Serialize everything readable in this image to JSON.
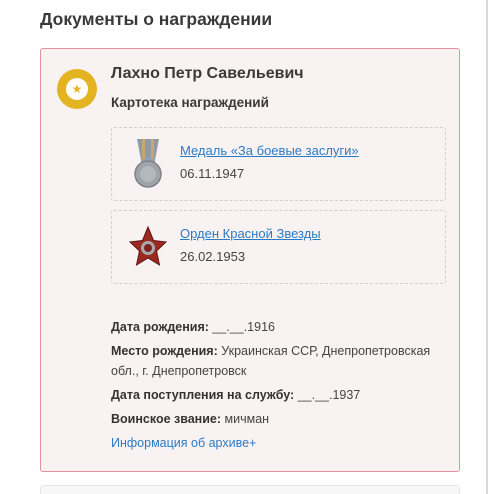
{
  "section": {
    "title": "Документы о награждении"
  },
  "card": {
    "person_name": "Лахно Петр Савельевич",
    "subtitle": "Картотека награждений",
    "awards": [
      {
        "name": "Медаль «За боевые заслуги»",
        "date": "06.11.1947",
        "icon": "medal-icon"
      },
      {
        "name": "Орден Красной Звезды",
        "date": "26.02.1953",
        "icon": "red-star-order-icon"
      }
    ],
    "info": {
      "birth_label": "Дата рождения:",
      "birth_value": " __.__.1916",
      "place_label": "Место рождения:",
      "place_value": " Украинская ССР, Днепропетровская обл., г. Днепропетровск",
      "service_label": "Дата поступления на службу:",
      "service_value": " __.__.1937",
      "rank_label": "Воинское звание:",
      "rank_value": " мичман"
    },
    "archive_link": "Информация об архиве+"
  },
  "colors": {
    "card_background": "#f9f2f2",
    "card_border": "#e4939a",
    "link": "#2b7bc4",
    "badge": "#e4b321"
  }
}
